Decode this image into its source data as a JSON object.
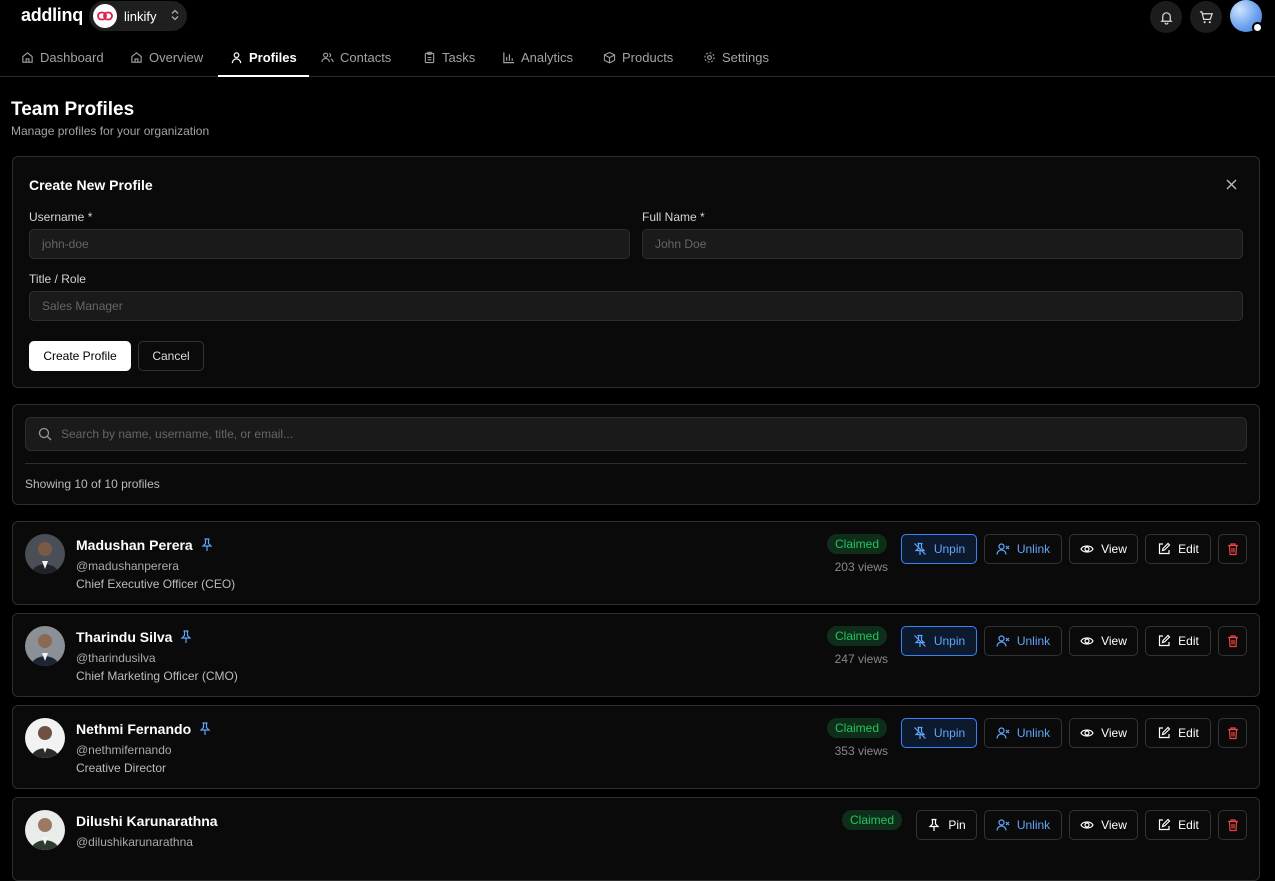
{
  "app": {
    "brand": "addlinq",
    "workspace": "linkify"
  },
  "nav": {
    "tabs": [
      {
        "label": "Dashboard",
        "icon": "home-icon"
      },
      {
        "label": "Overview",
        "icon": "home-icon"
      },
      {
        "label": "Profiles",
        "icon": "user-icon",
        "active": true
      },
      {
        "label": "Contacts",
        "icon": "users-icon"
      },
      {
        "label": "Tasks",
        "icon": "clipboard-icon"
      },
      {
        "label": "Analytics",
        "icon": "bar-chart-icon"
      },
      {
        "label": "Products",
        "icon": "box-icon"
      },
      {
        "label": "Settings",
        "icon": "gear-icon"
      }
    ]
  },
  "page": {
    "title": "Team Profiles",
    "subtitle": "Manage profiles for your organization"
  },
  "form": {
    "title": "Create New Profile",
    "username_label": "Username *",
    "username_placeholder": "john-doe",
    "fullname_label": "Full Name *",
    "fullname_placeholder": "John Doe",
    "title_label": "Title / Role",
    "title_placeholder": "Sales Manager",
    "create_label": "Create Profile",
    "cancel_label": "Cancel"
  },
  "list": {
    "search_placeholder": "Search by name, username, title, or email...",
    "showing": "Showing 10 of 10 profiles",
    "profiles": [
      {
        "name": "Madushan Perera",
        "username": "@madushanperera",
        "title": "Chief Executive Officer (CEO)",
        "status": "Claimed",
        "views": "203 views",
        "pin_label": "Unpin",
        "pinned": true
      },
      {
        "name": "Tharindu Silva",
        "username": "@tharindusilva",
        "title": "Chief Marketing Officer (CMO)",
        "status": "Claimed",
        "views": "247 views",
        "pin_label": "Unpin",
        "pinned": true
      },
      {
        "name": "Nethmi Fernando",
        "username": "@nethmifernando",
        "title": "Creative Director",
        "status": "Claimed",
        "views": "353 views",
        "pin_label": "Unpin",
        "pinned": true
      },
      {
        "name": "Dilushi Karunarathna",
        "username": "@dilushikarunarathna",
        "title": "",
        "status": "Claimed",
        "views": "",
        "pin_label": "Pin",
        "pinned": false
      }
    ],
    "unlink_label": "Unlink",
    "view_label": "View",
    "edit_label": "Edit"
  },
  "colors": {
    "accent": "#3b82f6",
    "claimed": "#22c55e",
    "danger": "#ef4444"
  }
}
